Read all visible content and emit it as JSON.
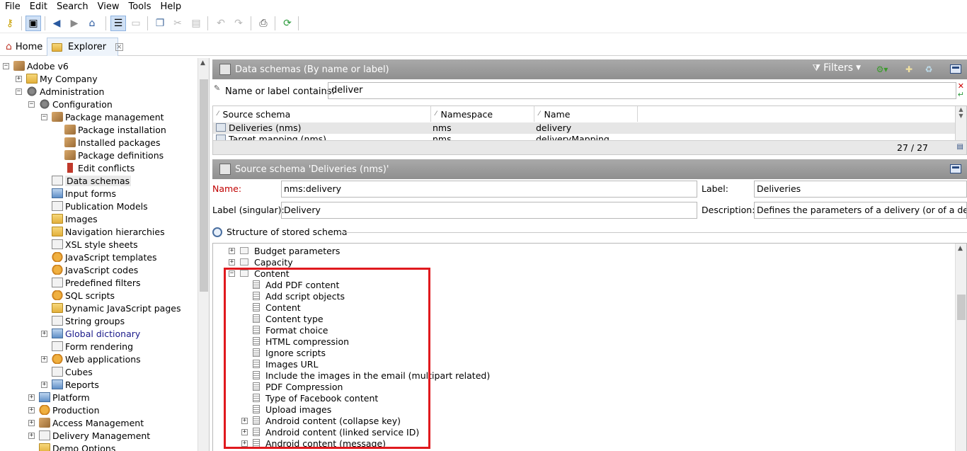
{
  "menu": [
    "File",
    "Edit",
    "Search",
    "View",
    "Tools",
    "Help"
  ],
  "tabs": {
    "home": "Home",
    "explorer": "Explorer"
  },
  "tree": [
    {
      "label": "Adobe v6",
      "indent": 0,
      "exp": "-",
      "icon": "pkg"
    },
    {
      "label": "My Company",
      "indent": 1,
      "exp": "+",
      "icon": "folder"
    },
    {
      "label": "Administration",
      "indent": 1,
      "exp": "-",
      "icon": "gear"
    },
    {
      "label": "Configuration",
      "indent": 2,
      "exp": "-",
      "icon": "gear"
    },
    {
      "label": "Package management",
      "indent": 3,
      "exp": "-",
      "icon": "pkg"
    },
    {
      "label": "Package installation",
      "indent": 4,
      "exp": "",
      "icon": "pkg"
    },
    {
      "label": "Installed packages",
      "indent": 4,
      "exp": "",
      "icon": "pkg"
    },
    {
      "label": "Package definitions",
      "indent": 4,
      "exp": "",
      "icon": "pkg"
    },
    {
      "label": "Edit conflicts",
      "indent": 4,
      "exp": "",
      "icon": "red"
    },
    {
      "label": "Data schemas",
      "indent": 3,
      "exp": "",
      "icon": "doc",
      "selected": true
    },
    {
      "label": "Input forms",
      "indent": 3,
      "exp": "",
      "icon": "blue"
    },
    {
      "label": "Publication Models",
      "indent": 3,
      "exp": "",
      "icon": "doc"
    },
    {
      "label": "Images",
      "indent": 3,
      "exp": "",
      "icon": "folder"
    },
    {
      "label": "Navigation hierarchies",
      "indent": 3,
      "exp": "",
      "icon": "folder"
    },
    {
      "label": "XSL style sheets",
      "indent": 3,
      "exp": "",
      "icon": "doc"
    },
    {
      "label": "JavaScript templates",
      "indent": 3,
      "exp": "",
      "icon": "orange"
    },
    {
      "label": "JavaScript codes",
      "indent": 3,
      "exp": "",
      "icon": "orange"
    },
    {
      "label": "Predefined filters",
      "indent": 3,
      "exp": "",
      "icon": "doc"
    },
    {
      "label": "SQL scripts",
      "indent": 3,
      "exp": "",
      "icon": "orange"
    },
    {
      "label": "Dynamic JavaScript pages",
      "indent": 3,
      "exp": "",
      "icon": "folder"
    },
    {
      "label": "String groups",
      "indent": 3,
      "exp": "",
      "icon": "doc"
    },
    {
      "label": "Global dictionary",
      "indent": 3,
      "exp": "+",
      "icon": "blue",
      "link": true
    },
    {
      "label": "Form rendering",
      "indent": 3,
      "exp": "",
      "icon": "doc"
    },
    {
      "label": "Web applications",
      "indent": 3,
      "exp": "+",
      "icon": "orange"
    },
    {
      "label": "Cubes",
      "indent": 3,
      "exp": "",
      "icon": "doc"
    },
    {
      "label": "Reports",
      "indent": 3,
      "exp": "+",
      "icon": "blue"
    },
    {
      "label": "Platform",
      "indent": 2,
      "exp": "+",
      "icon": "blue"
    },
    {
      "label": "Production",
      "indent": 2,
      "exp": "+",
      "icon": "orange"
    },
    {
      "label": "Access Management",
      "indent": 2,
      "exp": "+",
      "icon": "pkg"
    },
    {
      "label": "Delivery Management",
      "indent": 2,
      "exp": "+",
      "icon": "doc"
    },
    {
      "label": "Demo Options",
      "indent": 2,
      "exp": "",
      "icon": "folder"
    }
  ],
  "list_panel": {
    "title": "Data schemas (By name or label)",
    "filters_label": "Filters",
    "search_label": "Name or label contains:",
    "search_value": "deliver",
    "columns": [
      "Source schema",
      "Namespace",
      "Name"
    ],
    "rows": [
      [
        "Deliveries (nms)",
        "nms",
        "delivery"
      ],
      [
        "Target mapping (nms)",
        "nms",
        "deliveryMapping"
      ]
    ],
    "count": "27 / 27"
  },
  "detail_panel": {
    "title": "Source schema 'Deliveries (nms)'",
    "name_label": "Name:",
    "name_value": "nms:delivery",
    "label_label": "Label:",
    "label_value": "Deliveries",
    "singular_label": "Label (singular):",
    "singular_value": "Delivery",
    "desc_label": "Description:",
    "desc_value": "Defines the parameters of a delivery (or of a delive",
    "structure_label": "Structure of stored schema"
  },
  "structure": [
    {
      "label": "Budget parameters",
      "level": 0,
      "exp": "+",
      "type": "folder"
    },
    {
      "label": "Capacity",
      "level": 0,
      "exp": "+",
      "type": "folder"
    },
    {
      "label": "Content",
      "level": 0,
      "exp": "-",
      "type": "folder"
    },
    {
      "label": "Add PDF content",
      "level": 1,
      "exp": "",
      "type": "field"
    },
    {
      "label": "Add script objects",
      "level": 1,
      "exp": "",
      "type": "field"
    },
    {
      "label": "Content",
      "level": 1,
      "exp": "",
      "type": "field"
    },
    {
      "label": "Content type",
      "level": 1,
      "exp": "",
      "type": "field"
    },
    {
      "label": "Format choice",
      "level": 1,
      "exp": "",
      "type": "field"
    },
    {
      "label": "HTML compression",
      "level": 1,
      "exp": "",
      "type": "field"
    },
    {
      "label": "Ignore scripts",
      "level": 1,
      "exp": "",
      "type": "field"
    },
    {
      "label": "Images URL",
      "level": 1,
      "exp": "",
      "type": "field"
    },
    {
      "label": "Include the images in the email (multipart related)",
      "level": 1,
      "exp": "",
      "type": "field"
    },
    {
      "label": "PDF Compression",
      "level": 1,
      "exp": "",
      "type": "field"
    },
    {
      "label": "Type of Facebook content",
      "level": 1,
      "exp": "",
      "type": "field"
    },
    {
      "label": "Upload images",
      "level": 1,
      "exp": "",
      "type": "field"
    },
    {
      "label": "Android content (collapse key)",
      "level": 1,
      "exp": "+",
      "type": "field"
    },
    {
      "label": "Android content (linked service ID)",
      "level": 1,
      "exp": "+",
      "type": "field"
    },
    {
      "label": "Android content (message)",
      "level": 1,
      "exp": "+",
      "type": "field"
    }
  ],
  "colors": {
    "panel_header": "#9a9a9a",
    "highlight_box": "#e0191e",
    "name_label": "#c00000",
    "link": "#1a1a8a"
  }
}
